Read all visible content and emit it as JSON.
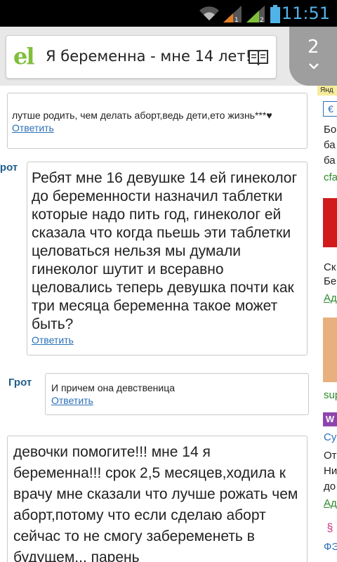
{
  "status_bar": {
    "time": "11:51",
    "icons": [
      "wifi-icon",
      "signal-1-icon",
      "signal-2-icon",
      "battery-icon"
    ]
  },
  "browser": {
    "logo_text": "el",
    "page_title": "Я беременна - мне 14 лет!",
    "tab_count": "2",
    "colors": {
      "logo": "#7fbf3b",
      "tabs": "#9e9e9e",
      "link": "#2a6fb6",
      "author": "#1e5d8a"
    }
  },
  "comments": [
    {
      "author": "",
      "text": "лутше родить, чем делать аборт,ведь дети,ето жизнь***♥",
      "reply": "Ответить"
    },
    {
      "author": "Грот",
      "text": "Ребят мне 16 девушке 14 ей гинеколог до беременности назначил таблетки которые надо пить год, гинеколог ей сказала что когда пьешь эти таблетки целоваться нельзя мы думали гинеколог шутит и всеравно целовались теперь девушка почти как три месяца беременна такое может быть?",
      "reply": "Ответить"
    },
    {
      "author": "Грот",
      "text": "И причем она девственица",
      "reply": "Ответить"
    },
    {
      "author": "",
      "text": "девочки помогите!!! мне 14 я беременна!!! срок 2,5 месяцев,ходила к врачу мне сказали что лучше рожать чем аборт,потому что если сделаю аборт сейчас то не смогу забеременеть в будущем... парень",
      "reply": ""
    }
  ],
  "ads": {
    "label": "Янд",
    "lines": [
      "Бо",
      "ба",
      "ба",
      "cfa",
      "Ск",
      "Бе",
      "Адр",
      "sup",
      "Су",
      "От",
      "Ни",
      "до",
      "Адр",
      "ФЭ"
    ]
  }
}
